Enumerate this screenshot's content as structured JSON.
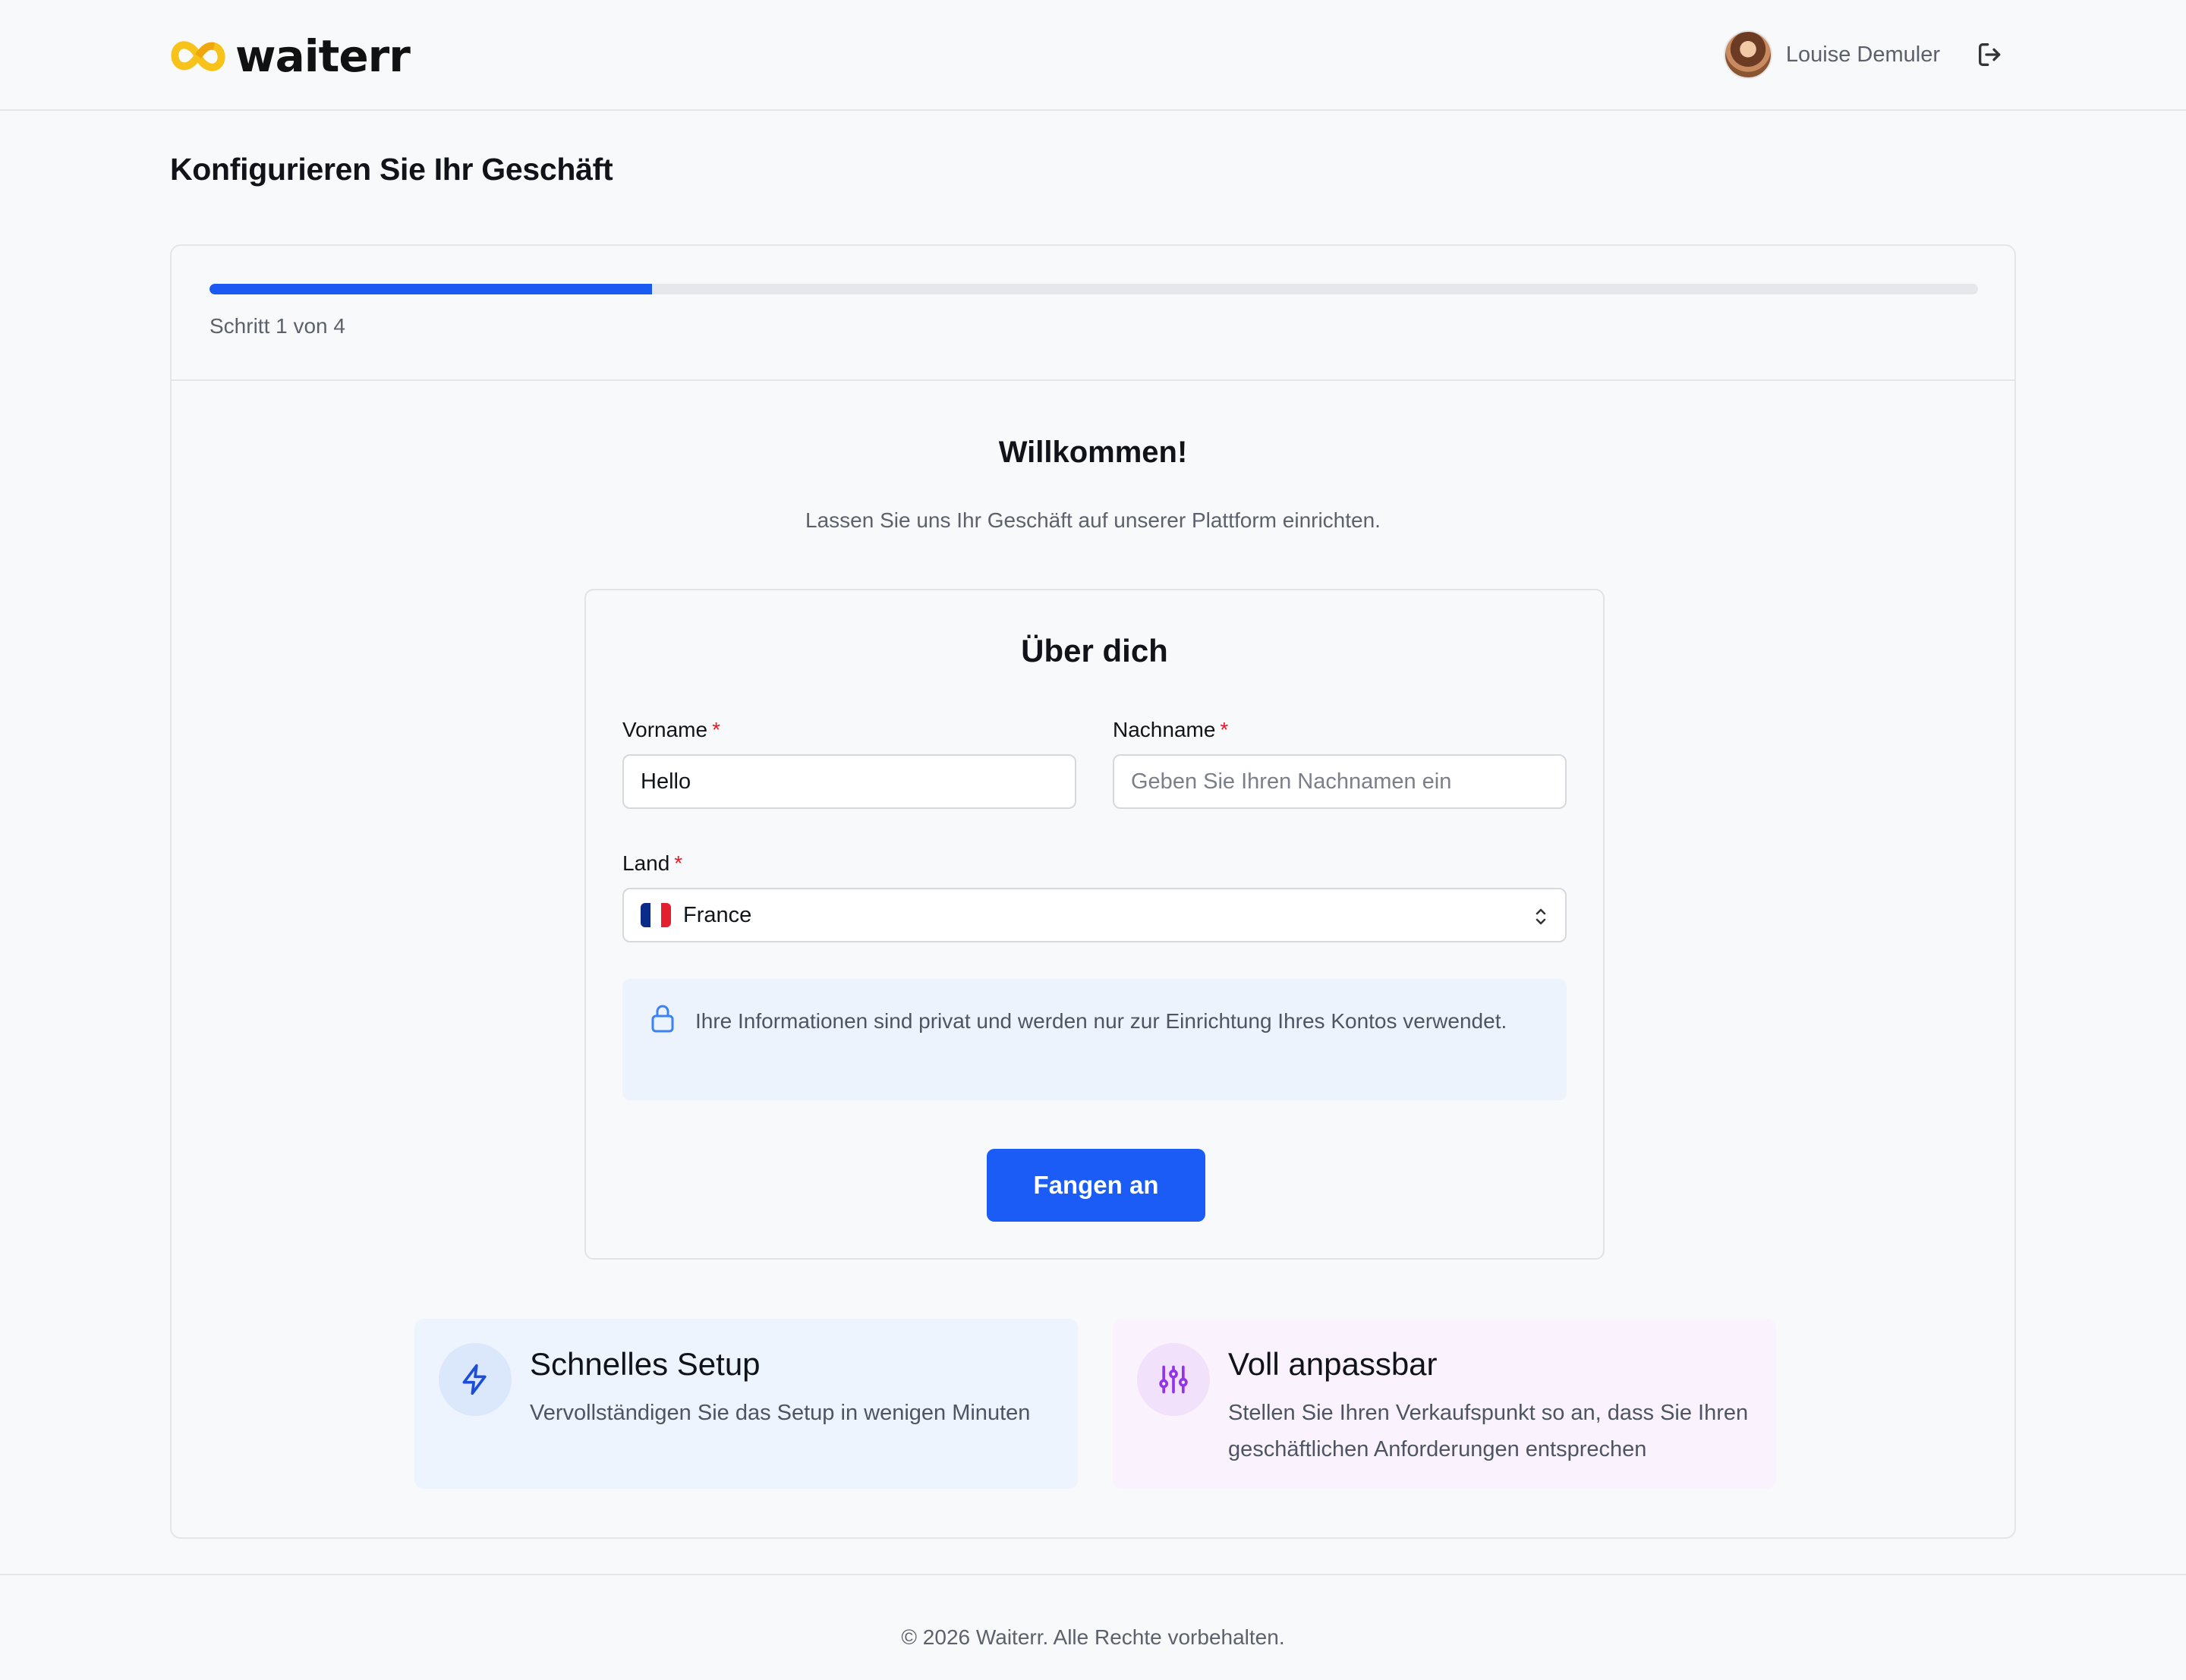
{
  "header": {
    "logo_text": "waiterr",
    "user_name": "Louise Demuler"
  },
  "page": {
    "title": "Konfigurieren Sie Ihr Geschäft"
  },
  "progress": {
    "step_text": "Schritt 1 von 4",
    "fraction": 0.25,
    "color": "#1b5af2"
  },
  "welcome": {
    "title": "Willkommen!",
    "subtitle": "Lassen Sie uns Ihr Geschäft auf unserer Plattform einrichten."
  },
  "form": {
    "title": "Über dich",
    "first_name": {
      "label": "Vorname",
      "required_mark": "*",
      "value": "Hello"
    },
    "last_name": {
      "label": "Nachname",
      "required_mark": "*",
      "placeholder": "Geben Sie Ihren Nachnamen ein"
    },
    "country": {
      "label": "Land",
      "required_mark": "*",
      "value": "France",
      "flag_icon": "flag-france-icon"
    },
    "privacy_note": "Ihre Informationen sind privat und werden nur zur Einrichtung Ihres Kontos verwendet.",
    "submit_label": "Fangen an",
    "accent_color": "#1a5cf5"
  },
  "features": [
    {
      "title": "Schnelles Setup",
      "description": "Vervollständigen Sie das Setup in wenigen Minuten",
      "icon": "lightning-icon"
    },
    {
      "title": "Voll anpassbar",
      "description": "Stellen Sie Ihren Verkaufspunkt so an, dass Sie Ihren geschäftlichen Anforderungen entsprechen",
      "icon": "sliders-icon"
    }
  ],
  "footer": {
    "copyright": "© 2026 Waiterr. Alle Rechte vorbehalten."
  }
}
